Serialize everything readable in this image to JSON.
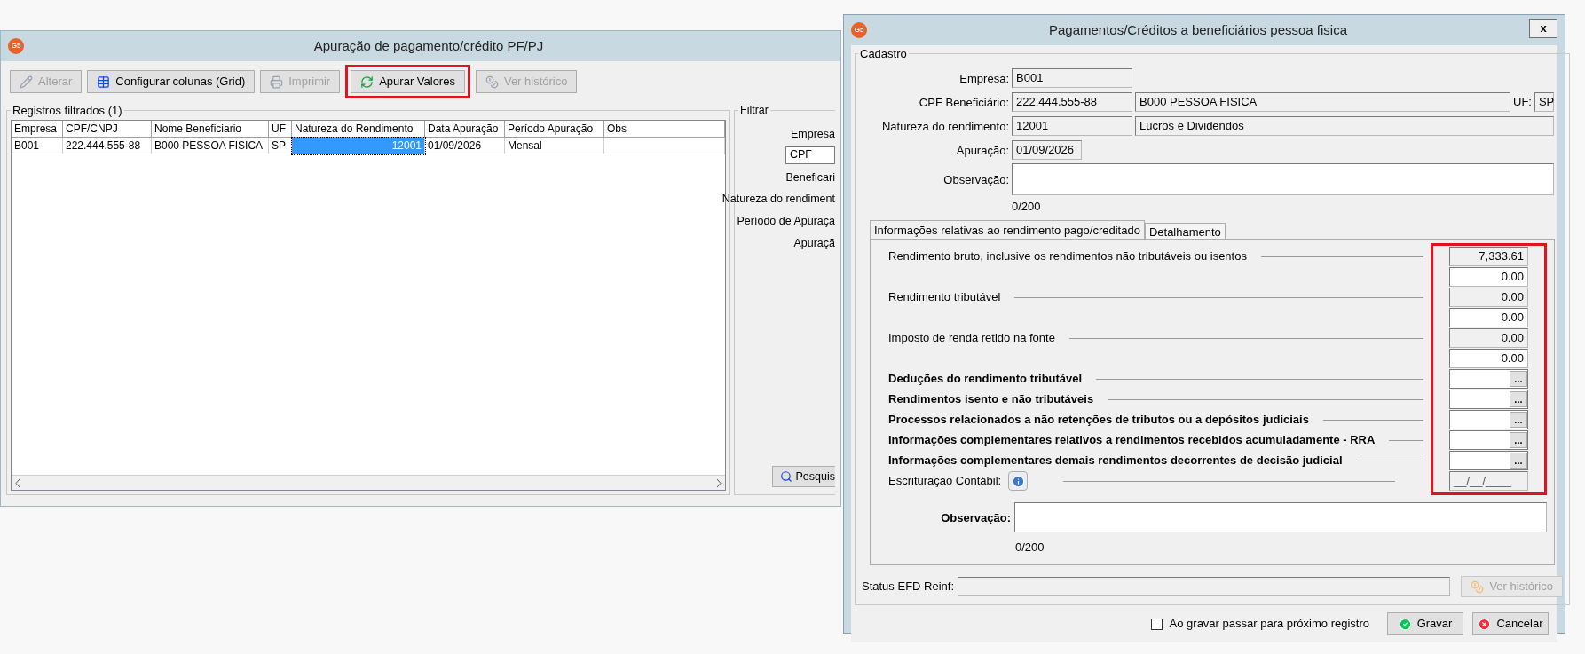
{
  "main_window": {
    "logo": "G5",
    "title": "Apuração de pagamento/crédito PF/PJ",
    "toolbar": [
      {
        "label": "Alterar",
        "kind": "edit",
        "disabled": true,
        "highlighted": false
      },
      {
        "label": "Configurar colunas (Grid)",
        "kind": "grid",
        "disabled": false,
        "highlighted": false
      },
      {
        "label": "Imprimir",
        "kind": "print",
        "disabled": true,
        "highlighted": false
      },
      {
        "label": "Apurar Valores",
        "kind": "refresh",
        "disabled": false,
        "highlighted": true
      },
      {
        "label": "Ver histórico",
        "kind": "coins",
        "disabled": true,
        "highlighted": false
      }
    ],
    "grid": {
      "title": "Registros filtrados (1)",
      "columns": [
        "Empresa",
        "CPF/CNPJ",
        "Nome Beneficiario",
        "UF",
        "Natureza do Rendimento",
        "Data Apuração",
        "Período Apuração",
        "Obs"
      ],
      "rows": [
        [
          {
            "text": "B001",
            "selected": false
          },
          {
            "text": "222.444.555-88",
            "selected": false
          },
          {
            "text": "B000 PESSOA FISICA",
            "selected": false
          },
          {
            "text": "SP",
            "selected": false
          },
          {
            "text": "12001",
            "selected": true
          },
          {
            "text": "01/09/2026",
            "selected": false
          },
          {
            "text": "Mensal",
            "selected": false
          },
          {
            "text": "",
            "selected": false
          }
        ]
      ]
    },
    "filter": {
      "title": "Filtrar",
      "empresa_label": "Empresa",
      "type_value": "CPF",
      "labels": [
        "Beneficari",
        "Natureza do rendiment",
        "Período de Apuraçã",
        "Apuraçã"
      ],
      "search_button": "Pesquis"
    }
  },
  "dialog": {
    "logo": "G5",
    "title": "Pagamentos/Créditos a beneficiários pessoa fisica",
    "close": "x",
    "cadastro": {
      "title": "Cadastro",
      "empresa": {
        "label": "Empresa:",
        "value": "B001"
      },
      "cpf": {
        "label": "CPF Beneficiário:",
        "value": "222.444.555-88",
        "name": "B000 PESSOA FISICA",
        "uf_label": "UF:",
        "uf": "SP"
      },
      "natureza": {
        "label": "Natureza do rendimento:",
        "value": "12001",
        "description": "Lucros e Dividendos"
      },
      "apuracao": {
        "label": "Apuração:",
        "value": "01/09/2026"
      },
      "observacao": {
        "label": "Observação:",
        "counter": "0/200"
      }
    },
    "tabs": [
      {
        "label": "Informações relativas ao rendimento pago/creditado",
        "selected": true
      },
      {
        "label": "Detalhamento",
        "selected": false
      }
    ],
    "rows": [
      {
        "label": "Rendimento bruto, inclusive os rendimentos não tributáveis ou isentos",
        "bold": false,
        "kind": "readonly",
        "value": "7,333.61"
      },
      {
        "kind": "input",
        "value": "0.00"
      },
      {
        "label": "Rendimento tributável",
        "bold": false,
        "kind": "readonly",
        "value": "0.00"
      },
      {
        "kind": "input",
        "value": "0.00"
      },
      {
        "label": "Imposto de renda retido na fonte",
        "bold": false,
        "kind": "readonly",
        "value": "0.00"
      },
      {
        "kind": "input",
        "value": "0.00"
      },
      {
        "label": "Deduções do rendimento tributável",
        "bold": true,
        "kind": "lookup",
        "button": "..."
      },
      {
        "label": "Rendimentos isento e não tributáveis",
        "bold": true,
        "kind": "lookup",
        "button": "..."
      },
      {
        "label": "Processos relacionados a não retenções de tributos ou a depósitos judiciais",
        "bold": true,
        "kind": "lookup",
        "button": "..."
      },
      {
        "label": "Informações complementares relativos a rendimentos recebidos acumuladamente - RRA",
        "bold": true,
        "kind": "lookup",
        "button": "..."
      },
      {
        "label": "Informações complementares demais rendimentos decorrentes de decisão judicial",
        "bold": true,
        "kind": "lookup",
        "button": "..."
      },
      {
        "label": "Escrituração Contábil:",
        "bold": false,
        "kind": "date",
        "value": "__/__/____",
        "info": true
      }
    ],
    "observacao": {
      "label": "Observação:",
      "counter": "0/200"
    },
    "status": {
      "label": "Status EFD Reinf:",
      "history_button": "Ver histórico",
      "history_disabled": true
    },
    "next_record": {
      "label": "Ao gravar passar para próximo registro",
      "checked": false
    },
    "buttons": [
      {
        "label": "Gravar",
        "kind": "save"
      },
      {
        "label": "Cancelar",
        "kind": "cancel"
      }
    ]
  }
}
